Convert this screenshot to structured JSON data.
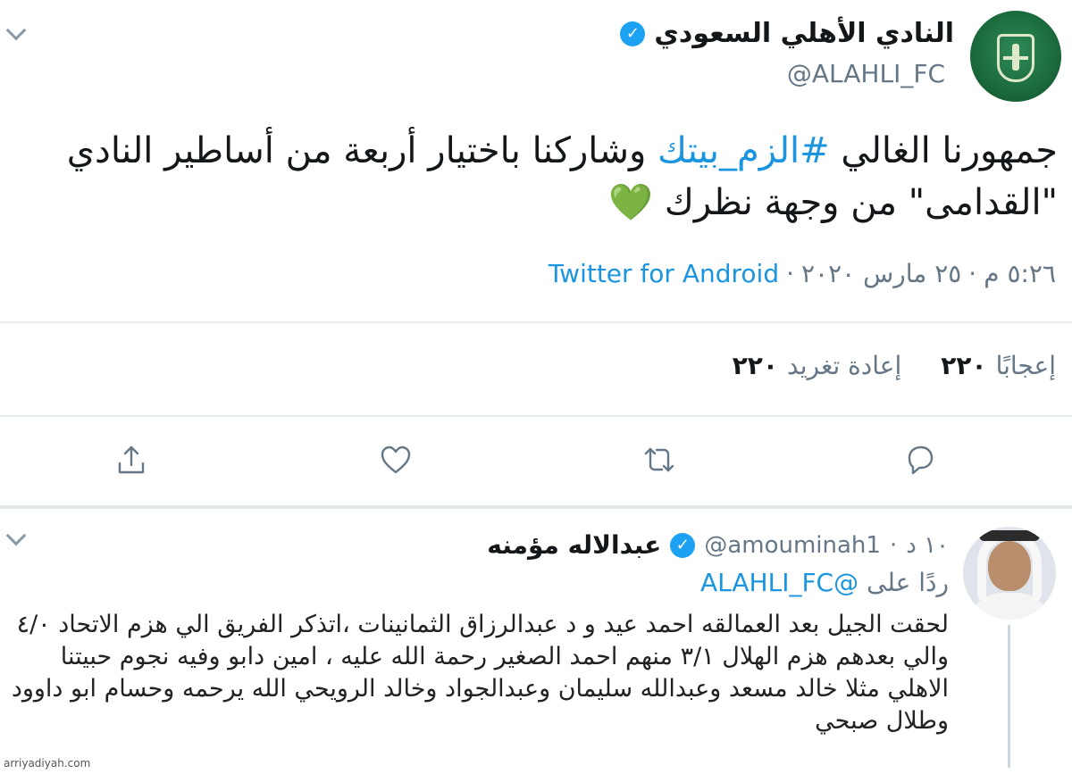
{
  "main_tweet": {
    "display_name": "النادي الأهلي السعودي",
    "handle": "@ALAHLI_FC",
    "text_before": "جمهورنا الغالي ",
    "hashtag": "#الزم_بيتك",
    "text_after": " وشاركنا باختيار أربعة من أساطير النادي \"القدامى\" من وجهة نظرك ",
    "emoji": "💚",
    "time": "٥:٢٦ م",
    "date": "٢٥ مارس ٢٠٢٠",
    "separator": "·",
    "source": "Twitter for Android",
    "retweets_count": "٢٢٠",
    "retweets_label": "إعادة تغريد",
    "likes_count": "٢٢٠",
    "likes_label": "إعجابًا",
    "icons": {
      "verified": "verified-badge-icon",
      "reply": "reply-icon",
      "retweet": "retweet-icon",
      "like": "heart-icon",
      "share": "share-icon",
      "menu": "chevron-down-icon"
    }
  },
  "reply_tweet": {
    "display_name": "عبدالاله مؤمنه",
    "handle": "@amouminah1",
    "time": "١٠ د",
    "separator": "·",
    "reply_to_label": "ردًا على",
    "reply_to_mention": "@ALAHLI_FC",
    "text": "لحقت الجيل بعد العمالقه احمد عيد و د عبدالرزاق الثمانينات ،اتذكر الفريق الي هزم الاتحاد ٤/٠ والي بعدهم هزم الهلال ٣/١ منهم احمد الصغير رحمة الله عليه ، امين دابو وفيه نجوم حبيتنا الاهلي مثلا خالد مسعد وعبدالله سليمان وعبدالجواد وخالد الرويحي الله يرحمه وحسام ابو داوود وطلال صبحي"
  },
  "watermark": "arriyadiyah.com",
  "colors": {
    "accent": "#1b95e0",
    "verified": "#1da1f2",
    "secondary_text": "#657786",
    "club_green": "#1a6a3c"
  }
}
